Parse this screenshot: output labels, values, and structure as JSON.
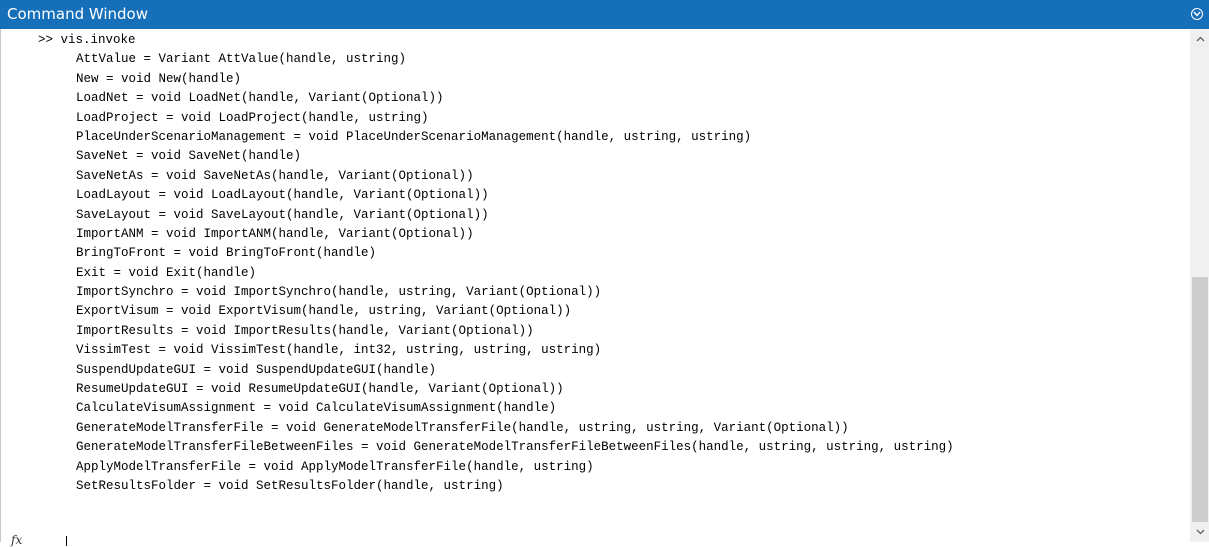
{
  "window": {
    "title": "Command Window"
  },
  "command": {
    "prompt": ">>",
    "text": "vis.invoke"
  },
  "output": [
    "AttValue = Variant AttValue(handle, ustring)",
    "New = void New(handle)",
    "LoadNet = void LoadNet(handle, Variant(Optional))",
    "LoadProject = void LoadProject(handle, ustring)",
    "PlaceUnderScenarioManagement = void PlaceUnderScenarioManagement(handle, ustring, ustring)",
    "SaveNet = void SaveNet(handle)",
    "SaveNetAs = void SaveNetAs(handle, Variant(Optional))",
    "LoadLayout = void LoadLayout(handle, Variant(Optional))",
    "SaveLayout = void SaveLayout(handle, Variant(Optional))",
    "ImportANM = void ImportANM(handle, Variant(Optional))",
    "BringToFront = void BringToFront(handle)",
    "Exit = void Exit(handle)",
    "ImportSynchro = void ImportSynchro(handle, ustring, Variant(Optional))",
    "ExportVisum = void ExportVisum(handle, ustring, Variant(Optional))",
    "ImportResults = void ImportResults(handle, Variant(Optional))",
    "VissimTest = void VissimTest(handle, int32, ustring, ustring, ustring)",
    "SuspendUpdateGUI = void SuspendUpdateGUI(handle)",
    "ResumeUpdateGUI = void ResumeUpdateGUI(handle, Variant(Optional))",
    "CalculateVisumAssignment = void CalculateVisumAssignment(handle)",
    "GenerateModelTransferFile = void GenerateModelTransferFile(handle, ustring, ustring, Variant(Optional))",
    "GenerateModelTransferFileBetweenFiles = void GenerateModelTransferFileBetweenFiles(handle, ustring, ustring, ustring)",
    "ApplyModelTransferFile = void ApplyModelTransferFile(handle, ustring)",
    "SetResultsFolder = void SetResultsFolder(handle, ustring)"
  ],
  "input": {
    "fx_label": "fx"
  },
  "colors": {
    "titlebar": "#1570b9",
    "scroll_thumb": "#cdcdcd",
    "scroll_track": "#f0f0f0"
  },
  "scroll": {
    "thumb_start_fraction": 0.48,
    "thumb_length_fraction": 0.48
  }
}
